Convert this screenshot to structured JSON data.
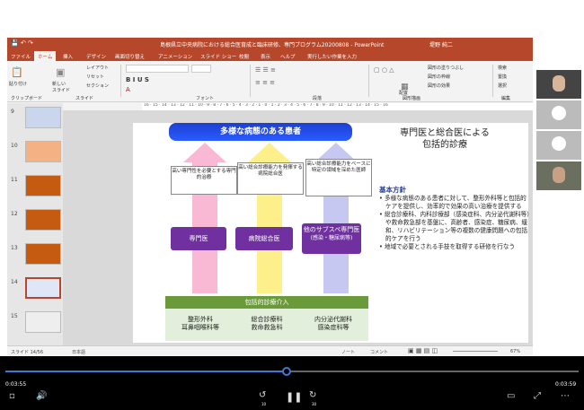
{
  "window": {
    "title": "島根県立中央病院における総合医育成と臨床研修、専門プログラム20200808 - PowerPoint",
    "user": "堤野 純二"
  },
  "menu": [
    "ファイル",
    "ホーム",
    "挿入",
    "デザイン",
    "画面切り替え",
    "アニメーション",
    "スライド ショー",
    "校閲",
    "表示",
    "ヘルプ",
    "実行したい作業を入力"
  ],
  "ribbon": {
    "paste": "貼り付け",
    "new_slide": "新しい スライド",
    "layout": "レイアウト",
    "reset": "リセット",
    "section": "セクション",
    "clipboard": "クリップボード",
    "slides": "スライド",
    "font": "フォント",
    "paragraph": "段落",
    "drawing": "図形描画",
    "arrange": "配置",
    "quick_styles": "クイック スタイル",
    "shape_fill": "図形の塗りつぶし",
    "shape_outline": "図形の枠線",
    "shape_effects": "図形の効果",
    "find": "検索",
    "replace": "置換",
    "select": "選択",
    "editing": "編集"
  },
  "ruler_text": "16 · 15 · 14 · 13 · 12 · 11 · 10 · 9 · 8 · 7 · 6 · 5 · 4 · 3 · 2 · 1 · 0 · 1 · 2 · 3 · 4 · 5 · 6 · 7 · 8 · 9 · 10 · 11 · 12 · 13 · 14 · 15 · 16",
  "thumbnails": [
    {
      "num": "9",
      "color": "#c9d6ee"
    },
    {
      "num": "10",
      "color": "#f4b183"
    },
    {
      "num": "11",
      "color": "#c55a11"
    },
    {
      "num": "12",
      "color": "#c55a11"
    },
    {
      "num": "13",
      "color": "#c55a11"
    },
    {
      "num": "14",
      "color": "#dfe6f5"
    },
    {
      "num": "15",
      "color": "#eeeeee"
    }
  ],
  "slide": {
    "banner": "多様な病態のある患者",
    "boxes": [
      "高い専門性を必要とする専門的治療",
      "高い総合診療能力を発揮する病院総合医",
      "高い総合診療能力をベースに特定の領域を深めた医師"
    ],
    "roles": [
      "専門医",
      "病院総合医",
      "他のサブスペ専門医",
      "(感染・糖尿病等)"
    ],
    "green_bar": "包括的診療介入",
    "green_cols": [
      [
        "整形外科",
        "耳鼻咽喉科等"
      ],
      [
        "総合診療科",
        "救命救急科"
      ],
      [
        "内分泌代謝科",
        "感染症科等"
      ]
    ],
    "right_title": [
      "専門医と総合医による",
      "包括的診療"
    ],
    "policy_head": "基本方針",
    "bullets": [
      "多様な病態のある患者に対して、整形外科等と包括的ケアを提供し、効率的で効果の高い治療を提供する",
      "総合診療科、内科診療部（感染症科、内分泌代謝科等）や救命救急部を基盤に、高齢者、感染症、糖尿病、緩和、リハビリテーション等の複数の健康問題への包括的ケアを行う",
      "地域で必要とされる手技を取得する研修を行なう"
    ]
  },
  "status": {
    "slide_info": "スライド 14/56",
    "lang": "日本語",
    "notes": "ノート",
    "comments": "コメント",
    "zoom": "67%"
  },
  "player": {
    "elapsed": "0:03:55",
    "remaining": "0:03:59",
    "progress": 0.49,
    "skip_back": "10",
    "skip_fwd": "30"
  }
}
